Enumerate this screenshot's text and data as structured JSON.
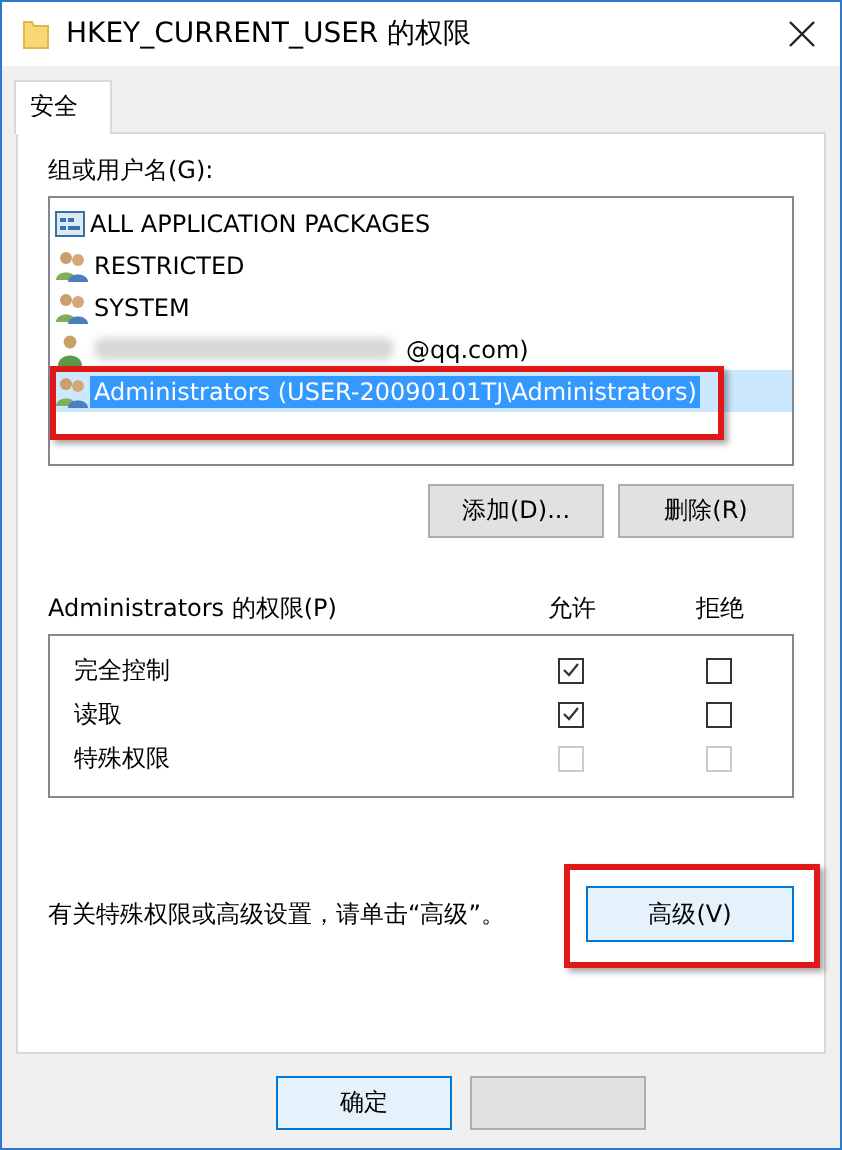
{
  "window": {
    "title": "HKEY_CURRENT_USER 的权限"
  },
  "tabs": [
    {
      "label": "安全",
      "selected": true
    }
  ],
  "groups": {
    "label": "组或用户名(G):",
    "items": [
      {
        "kind": "package",
        "name": "ALL APPLICATION PACKAGES",
        "selected": false,
        "redacted": false,
        "highlighted": false
      },
      {
        "kind": "group",
        "name": "RESTRICTED",
        "selected": false,
        "redacted": false,
        "highlighted": false
      },
      {
        "kind": "group",
        "name": "SYSTEM",
        "selected": false,
        "redacted": false,
        "highlighted": false
      },
      {
        "kind": "user",
        "name": "@qq.com)",
        "selected": false,
        "redacted": true,
        "highlighted": false
      },
      {
        "kind": "group",
        "name": "Administrators (USER-20090101TJ\\Administrators)",
        "selected": true,
        "redacted": false,
        "highlighted": true
      }
    ],
    "buttons": [
      "添加(D)...",
      "删除(R)"
    ]
  },
  "permissions": {
    "label": "Administrators 的权限(P)",
    "allow_header": "允许",
    "deny_header": "拒绝",
    "rows": [
      {
        "name": "完全控制",
        "allow": {
          "checked": true,
          "disabled": false
        },
        "deny": {
          "checked": false,
          "disabled": false
        }
      },
      {
        "name": "读取",
        "allow": {
          "checked": true,
          "disabled": false
        },
        "deny": {
          "checked": false,
          "disabled": false
        }
      },
      {
        "name": "特殊权限",
        "allow": {
          "checked": false,
          "disabled": true
        },
        "deny": {
          "checked": false,
          "disabled": true
        }
      }
    ]
  },
  "advanced": {
    "hint": "有关特殊权限或高级设置，请单击“高级”。",
    "button": "高级(V)",
    "highlighted": true
  },
  "footer_buttons": [
    {
      "label": "确定"
    }
  ]
}
